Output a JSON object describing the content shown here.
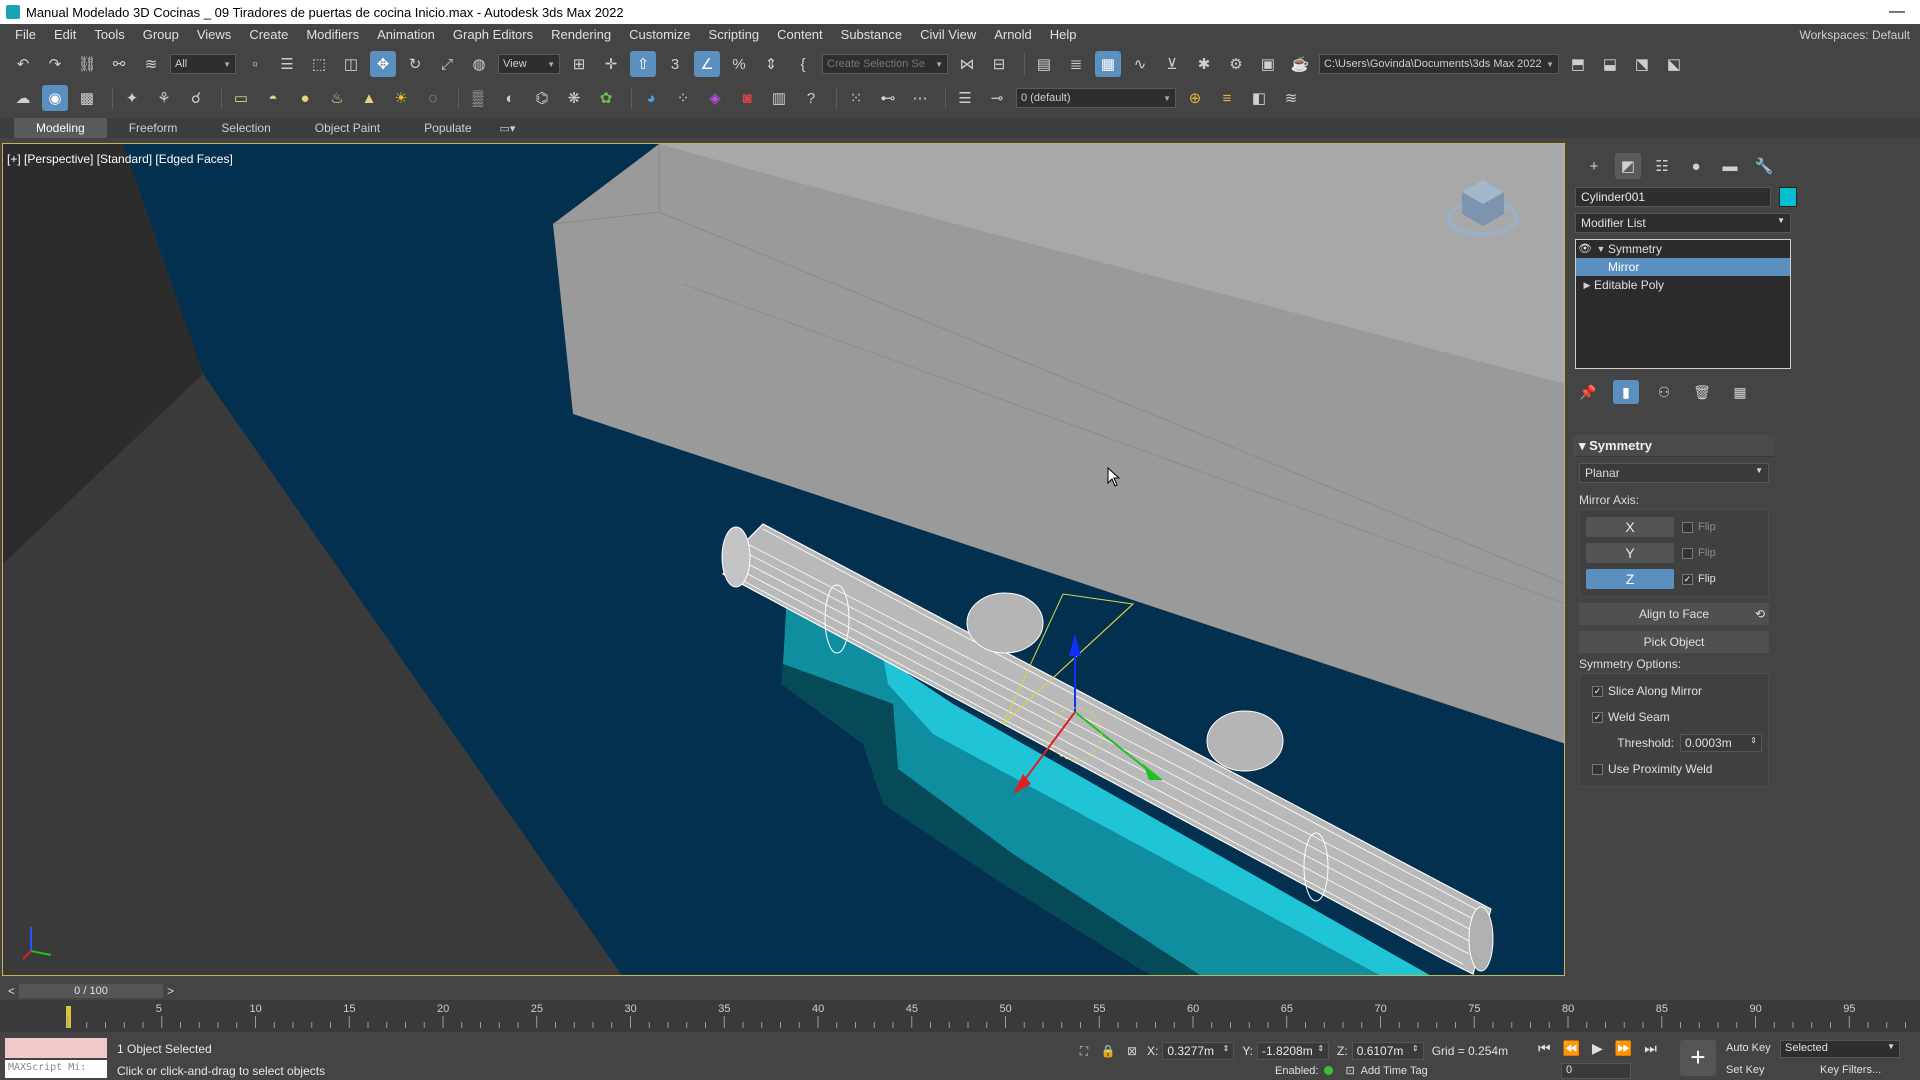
{
  "window": {
    "title": "Manual Modelado 3D Cocinas _ 09 Tiradores de puertas de cocina Inicio.max - Autodesk 3ds Max 2022",
    "minimize": "—"
  },
  "menu": {
    "items": [
      "File",
      "Edit",
      "Tools",
      "Group",
      "Views",
      "Create",
      "Modifiers",
      "Animation",
      "Graph Editors",
      "Rendering",
      "Customize",
      "Scripting",
      "Content",
      "Substance",
      "Civil View",
      "Arnold",
      "Help"
    ],
    "workspace": "Workspaces: Default"
  },
  "toolbar1": {
    "selection_filter": "All",
    "ref_coord": "View",
    "selection_set_placeholder": "Create Selection Se",
    "project_path": "C:\\Users\\Govinda\\Documents\\3ds Max 2022"
  },
  "toolbar2": {
    "layer": "0 (default)"
  },
  "ribbon": {
    "tabs": [
      "Modeling",
      "Freeform",
      "Selection",
      "Object Paint",
      "Populate"
    ]
  },
  "viewport": {
    "label": "[+] [Perspective] [Standard] [Edged Faces]"
  },
  "command_panel": {
    "object_name": "Cylinder001",
    "object_color": "#00c0d0",
    "modifier_list": "Modifier List",
    "stack": [
      {
        "label": "Symmetry",
        "level": 0,
        "expanded": true
      },
      {
        "label": "Mirror",
        "level": 1,
        "selected": true
      },
      {
        "label": "Editable Poly",
        "level": 0,
        "expanded": false
      }
    ],
    "rollout_title": "Symmetry",
    "mode": "Planar",
    "mirror_axis_label": "Mirror Axis:",
    "axes": [
      {
        "label": "X",
        "active": false,
        "flip": false
      },
      {
        "label": "Y",
        "active": false,
        "flip": false
      },
      {
        "label": "Z",
        "active": true,
        "flip": true
      }
    ],
    "flip_label": "Flip",
    "align_to_face": "Align to Face",
    "pick_object": "Pick Object",
    "symmetry_options_label": "Symmetry Options:",
    "slice_along_mirror": "Slice Along Mirror",
    "weld_seam": "Weld Seam",
    "threshold_label": "Threshold:",
    "threshold_value": "0.0003m",
    "use_proximity_weld": "Use Proximity Weld",
    "slice_checked": true,
    "weld_checked": true,
    "proximity_checked": false
  },
  "timeline": {
    "frame_display": "0 / 100",
    "ticks": [
      5,
      10,
      15,
      20,
      25,
      30,
      35,
      40,
      45,
      50,
      55,
      60,
      65,
      70,
      75,
      80,
      85,
      90,
      95
    ]
  },
  "status": {
    "selection": "1 Object Selected",
    "prompt": "Click or click-and-drag to select objects",
    "maxscript": "MAXScript Mi:",
    "x_label": "X:",
    "x_value": "0.3277m",
    "y_label": "Y:",
    "y_value": "-1.8208m",
    "z_label": "Z:",
    "z_value": "0.6107m",
    "grid": "Grid = 0.254m",
    "enabled": "Enabled:",
    "add_time_tag": "Add Time Tag",
    "frame": "0",
    "auto_key": "Auto Key",
    "set_key": "Set Key",
    "selected_dd": "Selected",
    "key_filters": "Key Filters..."
  }
}
